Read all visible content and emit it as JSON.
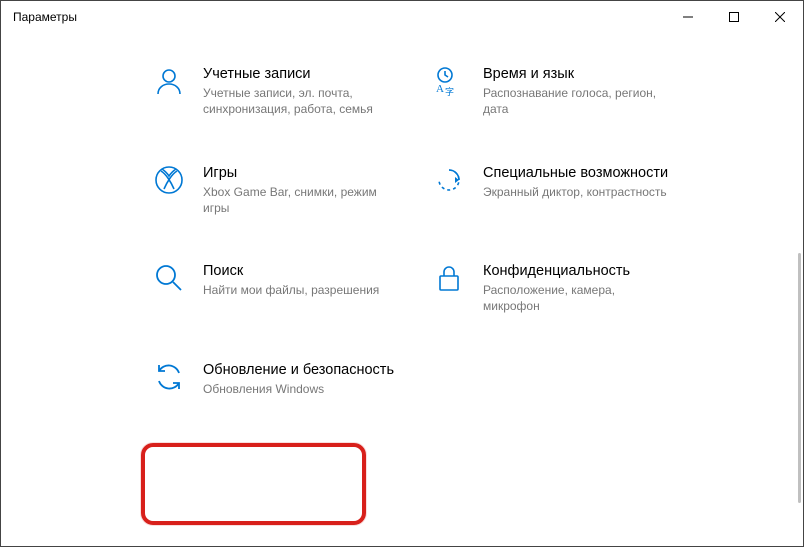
{
  "window": {
    "title": "Параметры"
  },
  "tiles": {
    "accounts": {
      "title": "Учетные записи",
      "sub": "Учетные записи, эл. почта, синхронизация, работа, семья"
    },
    "timeLanguage": {
      "title": "Время и язык",
      "sub": "Распознавание голоса, регион, дата"
    },
    "gaming": {
      "title": "Игры",
      "sub": "Xbox Game Bar, снимки, режим игры"
    },
    "easeOfAccess": {
      "title": "Специальные возможности",
      "sub": "Экранный диктор, контрастность"
    },
    "search": {
      "title": "Поиск",
      "sub": "Найти мои файлы, разрешения"
    },
    "privacy": {
      "title": "Конфиденциальность",
      "sub": "Расположение, камера, микрофон"
    },
    "update": {
      "title": "Обновление и безопасность",
      "sub": "Обновления Windows"
    }
  }
}
